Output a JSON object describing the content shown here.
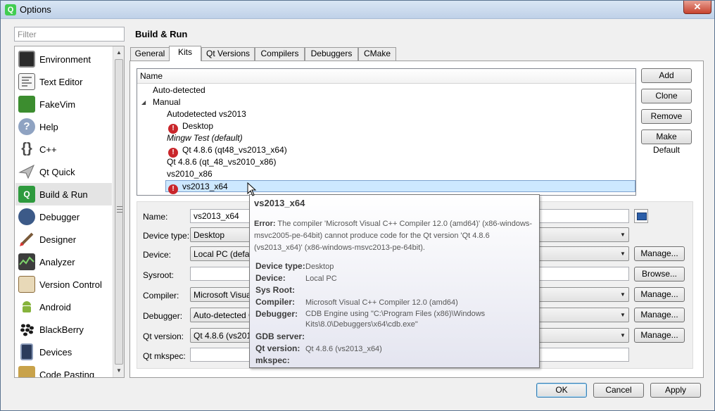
{
  "window": {
    "title": "Options",
    "app_icon_glyph": "Q",
    "close_glyph": "✕"
  },
  "filter": {
    "placeholder": "Filter"
  },
  "sidebar": {
    "items": [
      {
        "label": "Environment",
        "icon": "monitor-icon",
        "color": "#2a2a2a"
      },
      {
        "label": "Text Editor",
        "icon": "text-editor-icon",
        "color": "#606060"
      },
      {
        "label": "FakeVim",
        "icon": "fakevim-icon",
        "color": "#3c8d2f"
      },
      {
        "label": "Help",
        "icon": "help-icon",
        "color": "#5c6f8e"
      },
      {
        "label": "C++",
        "icon": "cpp-braces-icon",
        "color": "#4a4a4a"
      },
      {
        "label": "Qt Quick",
        "icon": "paper-plane-icon",
        "color": "#8a8a8a"
      },
      {
        "label": "Build & Run",
        "icon": "build-run-icon",
        "color": "#2e9a3e"
      },
      {
        "label": "Debugger",
        "icon": "debugger-icon",
        "color": "#3c5a88"
      },
      {
        "label": "Designer",
        "icon": "designer-icon",
        "color": "#7a5a3a"
      },
      {
        "label": "Analyzer",
        "icon": "analyzer-icon",
        "color": "#3d3d3d"
      },
      {
        "label": "Version Control",
        "icon": "version-control-icon",
        "color": "#8a6a3a"
      },
      {
        "label": "Android",
        "icon": "android-icon",
        "color": "#86b33c"
      },
      {
        "label": "BlackBerry",
        "icon": "blackberry-icon",
        "color": "#1a1a1a"
      },
      {
        "label": "Devices",
        "icon": "devices-icon",
        "color": "#2c3c5c"
      },
      {
        "label": "Code Pasting",
        "icon": "code-pasting-icon",
        "color": "#c8a24a"
      }
    ]
  },
  "page_title": "Build & Run",
  "tabs": [
    {
      "label": "General",
      "active": false
    },
    {
      "label": "Kits",
      "active": true
    },
    {
      "label": "Qt Versions",
      "active": false
    },
    {
      "label": "Compilers",
      "active": false
    },
    {
      "label": "Debuggers",
      "active": false
    },
    {
      "label": "CMake",
      "active": false
    }
  ],
  "kits_tree": {
    "header": "Name",
    "rows": [
      {
        "label": "Auto-detected",
        "error": false,
        "italic": false
      },
      {
        "label": "Manual",
        "error": false,
        "italic": false,
        "expanded": true
      },
      {
        "label": "Autodetected vs2013",
        "error": false,
        "italic": false
      },
      {
        "label": "Desktop",
        "error": true,
        "italic": false
      },
      {
        "label": "Mingw Test (default)",
        "error": false,
        "italic": true
      },
      {
        "label": "Qt 4.8.6 (qt48_vs2013_x64)",
        "error": true,
        "italic": false
      },
      {
        "label": "Qt 4.8.6 (qt_48_vs2010_x86)",
        "error": false,
        "italic": false
      },
      {
        "label": "vs2010_x86",
        "error": false,
        "italic": false
      },
      {
        "label": "vs2013_x64",
        "error": true,
        "italic": false,
        "selected": true
      }
    ],
    "error_glyph": "!"
  },
  "kit_buttons": {
    "add": "Add",
    "clone": "Clone",
    "remove": "Remove",
    "make_default": "Make Default"
  },
  "form": {
    "name_label": "Name:",
    "name_value": "vs2013_x64",
    "device_type_label": "Device type:",
    "device_type_value": "Desktop",
    "device_label": "Device:",
    "device_value": "Local PC (default",
    "sysroot_label": "Sysroot:",
    "sysroot_value": "",
    "compiler_label": "Compiler:",
    "compiler_value": "Microsoft Visual C",
    "debugger_label": "Debugger:",
    "debugger_value": "Auto-detected C",
    "qt_version_label": "Qt version:",
    "qt_version_value": "Qt 4.8.6 (vs201",
    "qt_mkspec_label": "Qt mkspec:",
    "qt_mkspec_value": "",
    "manage": "Manage...",
    "browse": "Browse...",
    "combo_arrow": "▼"
  },
  "tooltip": {
    "title": "vs2013_x64",
    "error_label": "Error:",
    "error_text": "The compiler 'Microsoft Visual C++ Compiler 12.0 (amd64)' (x86-windows-msvc2005-pe-64bit) cannot produce code for the Qt version 'Qt 4.8.6 (vs2013_x64)' (x86-windows-msvc2013-pe-64bit).",
    "rows": [
      {
        "key": "Device type:",
        "value": "Desktop"
      },
      {
        "key": "Device:",
        "value": "Local PC"
      },
      {
        "key": "Sys Root:",
        "value": ""
      },
      {
        "key": "Compiler:",
        "value": "Microsoft Visual C++ Compiler 12.0 (amd64)"
      },
      {
        "key": "Debugger:",
        "value": "CDB Engine using \"C:\\Program Files (x86)\\Windows Kits\\8.0\\Debuggers\\x64\\cdb.exe\""
      },
      {
        "key": "GDB server:",
        "value": ""
      },
      {
        "key": "Qt version:",
        "value": "Qt 4.8.6 (vs2013_x64)"
      },
      {
        "key": "mkspec:",
        "value": ""
      }
    ]
  },
  "dialog_buttons": {
    "ok": "OK",
    "cancel": "Cancel",
    "apply": "Apply"
  },
  "colors": {
    "error": "#c9262b",
    "selection": "#cde8ff",
    "accent": "#3c7fb1"
  }
}
